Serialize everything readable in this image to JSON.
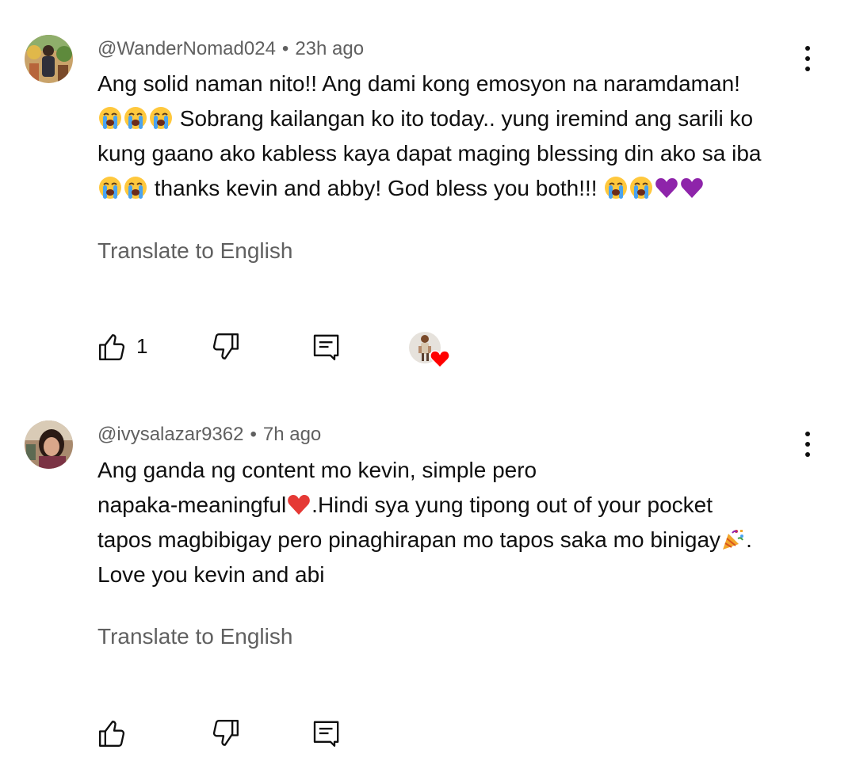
{
  "comments": [
    {
      "author": "@WanderNomad024",
      "separator": "•",
      "time": "23h ago",
      "lines": [
        [
          "Ang solid naman nito!! Ang dami kong emosyon na naramdaman!"
        ],
        [
          "crying-emoji",
          "crying-emoji",
          "crying-emoji",
          " Sobrang kailangan ko ito today.. yung iremind ang sarili ko"
        ],
        [
          "kung gaano ako kabless kaya dapat maging blessing din ako sa iba"
        ],
        [
          "crying-emoji",
          "crying-emoji",
          " thanks kevin and abby! God bless you both!!! ",
          "crying-emoji",
          "crying-emoji",
          "purple-heart-emoji",
          "purple-heart-emoji"
        ]
      ],
      "translate_label": "Translate to English",
      "like_count": "1",
      "has_creator_heart": true
    },
    {
      "author": "@ivysalazar9362",
      "separator": "•",
      "time": "7h ago",
      "lines": [
        [
          "Ang ganda ng content mo kevin, simple pero"
        ],
        [
          "napaka-meaningful",
          "red-heart-emoji",
          ".Hindi sya yung tipong out of your pocket"
        ],
        [
          "tapos magbibigay pero pinaghirapan mo tapos saka mo binigay",
          "party-popper-emoji",
          "."
        ],
        [
          "Love you kevin and abi"
        ]
      ],
      "translate_label": "Translate to English",
      "like_count": "",
      "has_creator_heart": false
    }
  ],
  "icons": {
    "like": "thumbs-up-icon",
    "dislike": "thumbs-down-icon",
    "reply": "reply-icon",
    "menu": "more-vert-icon"
  },
  "colors": {
    "text": "#0f0f0f",
    "secondary": "#606060",
    "heart": "#ff0000",
    "purple": "#8e24aa"
  }
}
